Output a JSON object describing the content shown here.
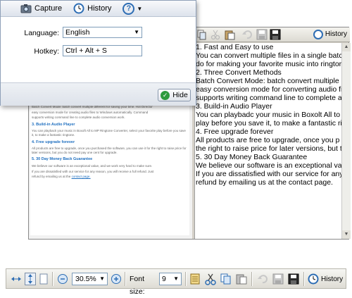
{
  "dialog": {
    "toolbar": {
      "capture_label": "Capture",
      "history_label": "History",
      "help_symbol": "?"
    },
    "language_label": "Language:",
    "language_value": "English",
    "hotkey_label": "Hotkey:",
    "hotkey_value": "Ctrl + Alt + S",
    "hide_label": "Hide"
  },
  "editor": {
    "history_label": "History",
    "text_lines": [
      "1. Fast and Easy to use",
      "You can convert multiple files in a single batch",
      "do for making your favorite music into ringtor",
      "2. Three Convert Methods",
      "Batch Convert Mode: batch convert multiple",
      "easy conversion mode for converting audio fi",
      "supports writing command line to complete a",
      "3. Build-in Audio Player",
      "You can playbadc your music in Boxolt All to /",
      "play before you save it, to make a fantastic ri",
      "4. Free upgrade forever",
      "All products are free to upgrade, once you p",
      "the right to raise price for later versions, but t",
      "5. 30 Day Money Back Guarantee",
      "We believe our software is an exceptional val",
      "If you are dissatisfied with our service for any",
      "refund by emailing us at the contact page."
    ]
  },
  "preview": {
    "lines_top": [
      "Batch Convert Mode: batch convert multiple different for saving your time. Hot Director",
      "easy conversion mode for creating audio files to Windows automatically. Command",
      "supports writing command line to complete audio conversion work."
    ],
    "heading3": "3. Build-in Audio Player",
    "para3": "You can playback your music in Boxoft All to MP Ringtone Converter, select your favorite play before you save it, to make a fantastic ringtone.",
    "heading4": "4. Free upgrade forever",
    "para4": "All products are free to upgrade, once you purchased the software, you can use it for the right to raise price for later versions, but you do not need pay one cent for upgrade.",
    "heading5": "5. 30 Day Money Back Guarantee",
    "para5a": "We believe our software is an exceptional value, and we work very hard to make sure.",
    "para5b": "If you are dissatisfied with our service for any reason, you will receive a full refund. Just",
    "para5c": "refund by emailing us at the",
    "link": "contact page."
  },
  "bottom_toolbar": {
    "zoom_value": "30.5%",
    "font_size_label": "Font size:",
    "font_size_value": "9",
    "history_label": "History"
  },
  "colors": {
    "accent_blue": "#2d6db4",
    "link_blue": "#2070c0",
    "hide_green": "#2e9a3c"
  }
}
